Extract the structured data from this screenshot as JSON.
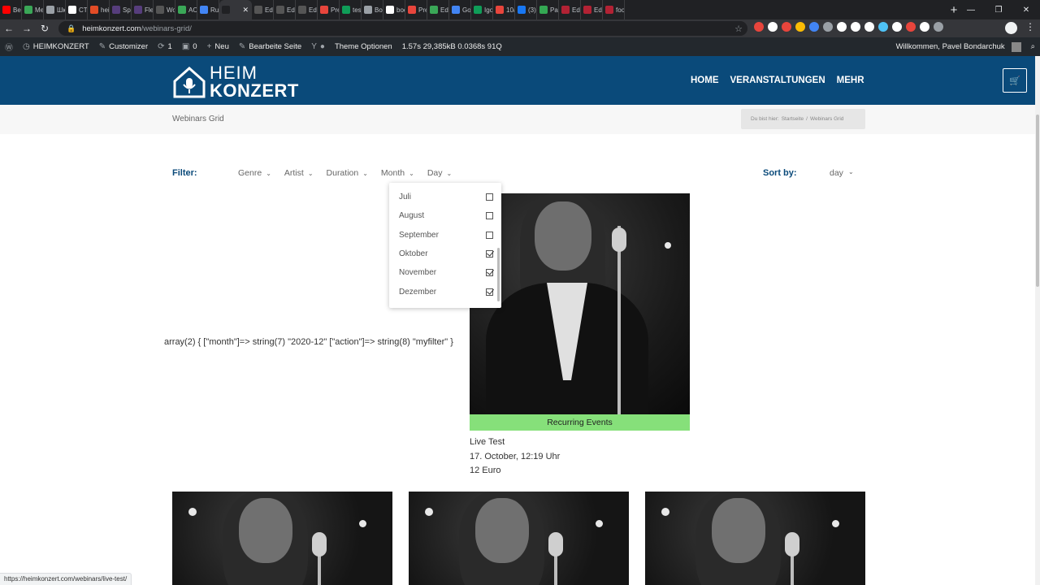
{
  "browser": {
    "tabs": [
      {
        "label": "Bes",
        "color": "#ff0000"
      },
      {
        "label": "Met",
        "color": "#3aa757"
      },
      {
        "label": "Шк",
        "color": "#9aa0a6"
      },
      {
        "label": "CTE",
        "color": "#ffffff"
      },
      {
        "label": "heim",
        "color": "#e34c26"
      },
      {
        "label": "Spin",
        "color": "#563d7c"
      },
      {
        "label": "Flex",
        "color": "#563d7c"
      },
      {
        "label": "Wor",
        "color": "#555555"
      },
      {
        "label": "ACI",
        "color": "#3aa757"
      },
      {
        "label": "Rus",
        "color": "#4285f4"
      },
      {
        "label": "",
        "color": "#202124",
        "active": true
      },
      {
        "label": "Edit",
        "color": "#555555"
      },
      {
        "label": "Edit",
        "color": "#555555"
      },
      {
        "label": "Edit",
        "color": "#555555"
      },
      {
        "label": "Pre",
        "color": "#e8453c"
      },
      {
        "label": "test",
        "color": "#0f9d58"
      },
      {
        "label": "Boo",
        "color": "#9aa0a6"
      },
      {
        "label": "boo",
        "color": "#ffffff"
      },
      {
        "label": "Pre",
        "color": "#e8453c"
      },
      {
        "label": "Edit",
        "color": "#3aa757"
      },
      {
        "label": "Goo",
        "color": "#4285f4"
      },
      {
        "label": "Igo",
        "color": "#0f9d58"
      },
      {
        "label": "10a",
        "color": "#e8453c"
      },
      {
        "label": "(3) I",
        "color": "#1877f2"
      },
      {
        "label": "Pac",
        "color": "#34a853"
      },
      {
        "label": "Edit",
        "color": "#b22234"
      },
      {
        "label": "Edit",
        "color": "#b22234"
      },
      {
        "label": "foo",
        "color": "#b22234"
      }
    ],
    "new_tab": "+",
    "window_controls": {
      "minimize": "—",
      "restore": "❐",
      "close": "✕"
    },
    "nav": {
      "back": "←",
      "forward": "→",
      "reload": "↻"
    },
    "url_host": "heimkonzert.com",
    "url_path": "/webinars-grid/",
    "extension_colors": [
      "#e8453c",
      "#ffffff",
      "#e8453c",
      "#fbbc05",
      "#4285f4",
      "#9aa0a6",
      "#ffffff",
      "#ffffff",
      "#ffffff",
      "#4fc3f7",
      "#ffffff",
      "#e8453c",
      "#ffffff",
      "#9aa0a6"
    ],
    "status_url": "https://heimkonzert.com/webinars/live-test/"
  },
  "adminbar": {
    "site_name": "HEIMKONZERT",
    "customizer": "Customizer",
    "updates": "1",
    "comments": "0",
    "new": "Neu",
    "edit_page": "Bearbeite Seite",
    "theme_options": "Theme Optionen",
    "stats": "1.57s   29,385kB   0.0368s   91Q",
    "greeting": "Willkommen, Pavel Bondarchuk"
  },
  "header": {
    "logo_top": "HEIM",
    "logo_bottom": "KONZERT",
    "nav": [
      "HOME",
      "VERANSTALTUNGEN",
      "MEHR"
    ],
    "accent": "#0a4a7a"
  },
  "title_band": {
    "title": "Webinars Grid",
    "breadcrumb_prefix": "Du bist hier:",
    "breadcrumb_home": "Startseite",
    "breadcrumb_sep": "/",
    "breadcrumb_current": "Webinars Grid"
  },
  "filters": {
    "label": "Filter:",
    "items": [
      "Genre",
      "Artist",
      "Duration",
      "Month",
      "Day"
    ],
    "sort_label": "Sort by:",
    "sort_value": "day"
  },
  "month_dropdown": [
    {
      "label": "Juli",
      "checked": false
    },
    {
      "label": "August",
      "checked": false
    },
    {
      "label": "September",
      "checked": false
    },
    {
      "label": "Oktober",
      "checked": true
    },
    {
      "label": "November",
      "checked": true
    },
    {
      "label": "Dezember",
      "checked": true
    }
  ],
  "debug_output": "array(2) { [\"month\"]=> string(7) \"2020-12\" [\"action\"]=> string(8) \"myfilter\" }",
  "event": {
    "badge": "Recurring Events",
    "badge_color": "#86e07a",
    "title": "Live Test",
    "date": "17. October, 12:19 Uhr",
    "price": "12 Euro"
  }
}
